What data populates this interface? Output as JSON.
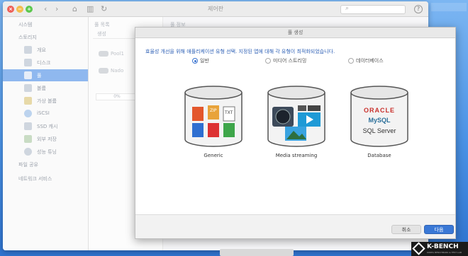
{
  "window": {
    "title": "제어판",
    "search_placeholder": "",
    "help": "?"
  },
  "sidebar": {
    "heading1": "시스템",
    "heading2": "스토리지",
    "items": [
      {
        "label": "개요",
        "icon": "overview-icon"
      },
      {
        "label": "디스크",
        "icon": "disk-icon"
      },
      {
        "label": "풀",
        "icon": "pool-icon"
      },
      {
        "label": "볼륨",
        "icon": "volume-icon"
      },
      {
        "label": "가상 볼륨",
        "icon": "virtual-volume-icon"
      },
      {
        "label": "iSCSI",
        "icon": "iscsi-icon"
      },
      {
        "label": "SSD 캐시",
        "icon": "ssd-cache-icon"
      },
      {
        "label": "외부 저장",
        "icon": "external-storage-icon"
      },
      {
        "label": "성능 튜닝",
        "icon": "tuning-icon"
      }
    ],
    "heading3": "파일 공유",
    "heading4": "네트워크 서비스"
  },
  "mid": {
    "heading": "풀 목록",
    "tab": "생성",
    "pools": [
      "Pool1",
      "Nado"
    ],
    "usage": "0%"
  },
  "info": {
    "heading": "풀 정보"
  },
  "dialog": {
    "title": "풀 생성",
    "description": "효율성 개선을 위해 애플리케이션 유형 선택. 지정된 앱에 대해 각 유형이 최적화되었습니다.",
    "options": [
      {
        "label": "일반",
        "caption": "Generic",
        "selected": true
      },
      {
        "label": "미디어 스트리밍",
        "caption": "Media streaming",
        "selected": false
      },
      {
        "label": "데이터베이스",
        "caption": "Database",
        "selected": false
      }
    ],
    "db_logos": {
      "oracle": "ORACLE",
      "mysql": "MySQL",
      "sqlserver": "SQL Server"
    },
    "file_tags": {
      "zip": "ZIP",
      "txt": "TXT"
    },
    "cancel": "취소",
    "next": "다음"
  },
  "watermark": {
    "brand": "K-BENCH",
    "tagline": "KOREA BENCHMARK & TEST LAB"
  },
  "colors": {
    "accent": "#3a78d6",
    "desktop": "#4b93e6",
    "selection": "#8fb8ef"
  }
}
